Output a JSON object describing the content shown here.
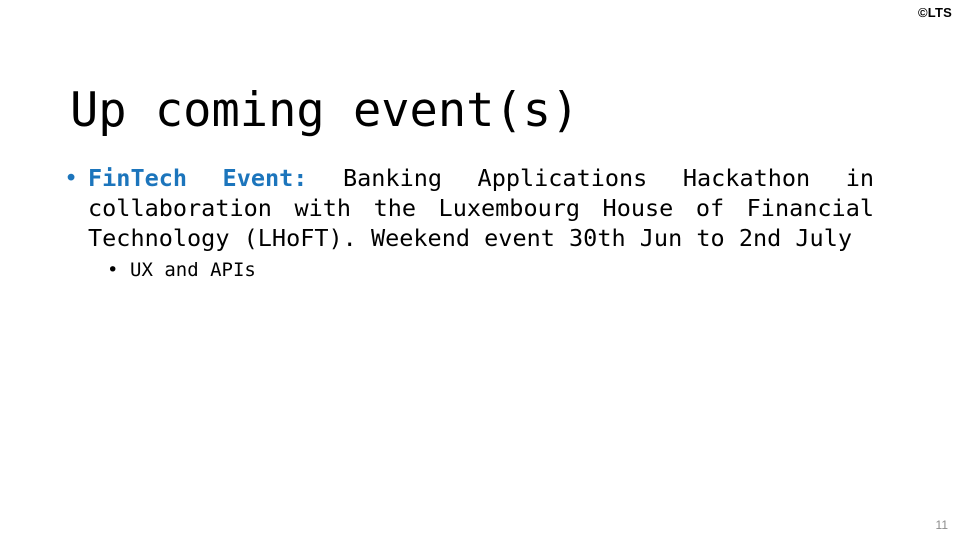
{
  "slide": {
    "copyright": "©LTS",
    "title": "Up coming event(s)",
    "page_number": "11",
    "accent_color": "#1c75bc",
    "text_color": "#000000",
    "background_color": "#ffffff",
    "page_number_color": "#8c8c8c"
  },
  "bullets": [
    {
      "marker": "•",
      "level": 1,
      "lead_label": "FinTech Event:",
      "lead_color": "#1c75bc",
      "body": "Banking Applications Hackathon in collaboration with the Luxembourg House of Financial Technology (LHoFT). Weekend event 30th Jun to 2nd July"
    },
    {
      "marker": "•",
      "level": 2,
      "body": "UX and APIs"
    }
  ]
}
